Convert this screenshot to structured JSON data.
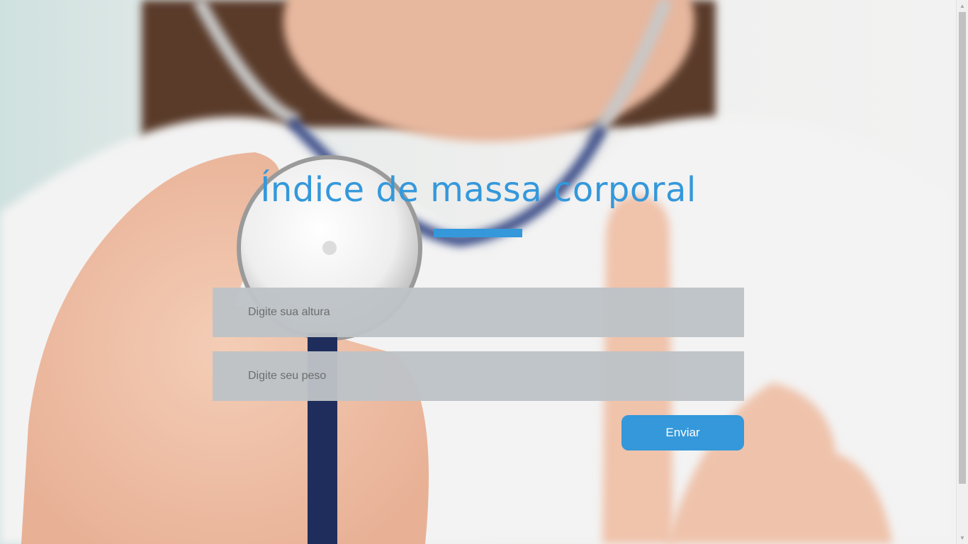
{
  "page": {
    "title": "Índice de massa corporal"
  },
  "form": {
    "height_placeholder": "Digite sua altura",
    "weight_placeholder": "Digite seu peso",
    "submit_label": "Enviar"
  },
  "colors": {
    "accent": "#3498db",
    "input_background": "#bdc3c7",
    "button_text": "#ffffff"
  },
  "background": {
    "subject": "doctor-with-stethoscope-photo"
  }
}
